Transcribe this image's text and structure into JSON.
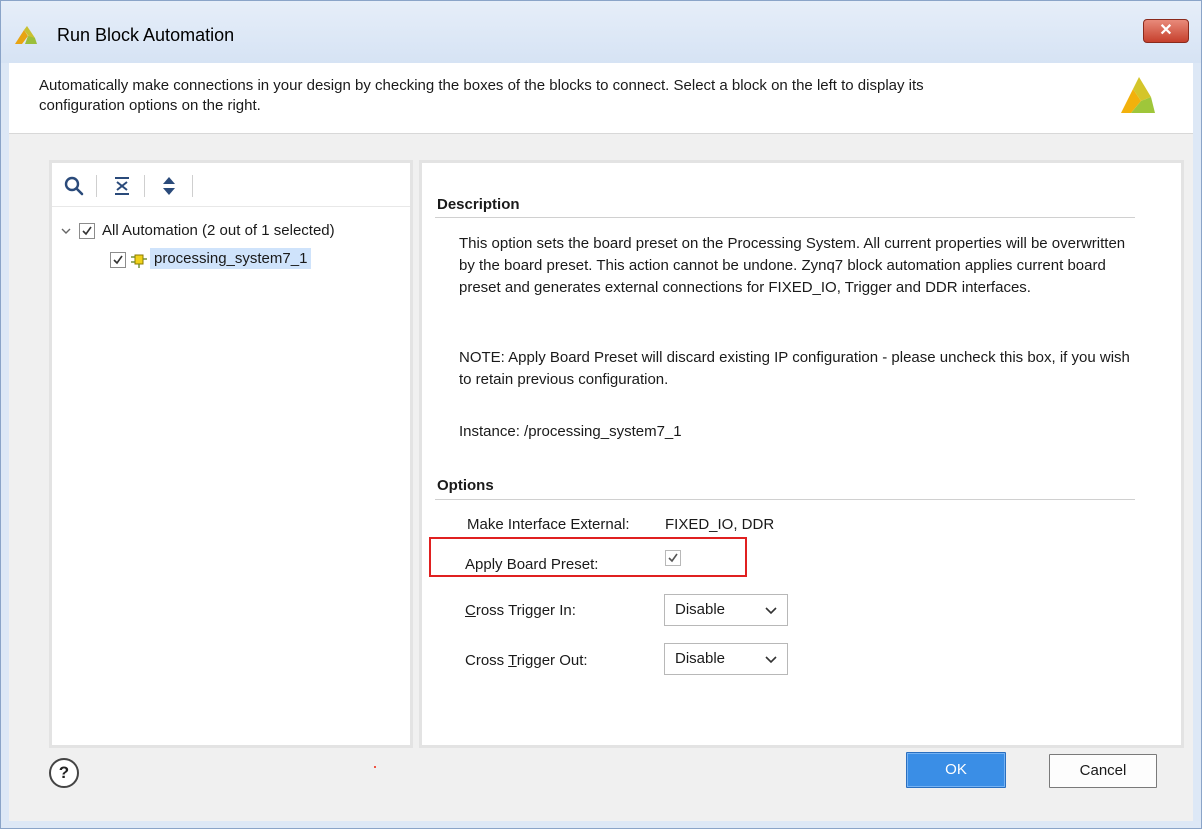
{
  "window": {
    "title": "Run Block Automation",
    "close_label": "✕"
  },
  "header": {
    "text_line1": "Automatically make connections in your design by checking the boxes of the blocks to connect. Select a block on the left to display its",
    "text_line2": "configuration options on the right."
  },
  "tree": {
    "toolbar": [
      "search-icon",
      "collapse-all-icon",
      "expand-all-icon"
    ],
    "root_label": "All Automation (2 out of 1 selected)",
    "root_checked": true,
    "child_label": "processing_system7_1",
    "child_checked": true
  },
  "description": {
    "title": "Description",
    "para1": "This option sets the board preset on the Processing System. All current properties will be overwritten by the board preset. This action cannot be undone. Zynq7 block automation applies current board preset and generates external connections for FIXED_IO, Trigger and DDR interfaces.",
    "para2": "NOTE: Apply Board Preset will discard existing IP configuration - please uncheck this box, if you wish to retain previous configuration.",
    "instance": "Instance: /processing_system7_1"
  },
  "options": {
    "title": "Options",
    "make_interface_label": "Make Interface External:",
    "make_interface_value": "FIXED_IO, DDR",
    "apply_preset_label": "Apply Board Preset:",
    "apply_preset_checked": true,
    "cross_in_label_first": "C",
    "cross_in_label_rest": "ross Trigger In:",
    "cross_in_value": "Disable",
    "cross_out_label_prefix": "Cross ",
    "cross_out_label_underlined": "T",
    "cross_out_label_rest": "rigger Out:",
    "cross_out_value": "Disable"
  },
  "footer": {
    "help_label": "?",
    "ok_label": "OK",
    "cancel_label": "Cancel"
  },
  "colors": {
    "highlight": "#e02020",
    "ok_button": "#3a8ee6",
    "selection": "#cfe3fb"
  }
}
